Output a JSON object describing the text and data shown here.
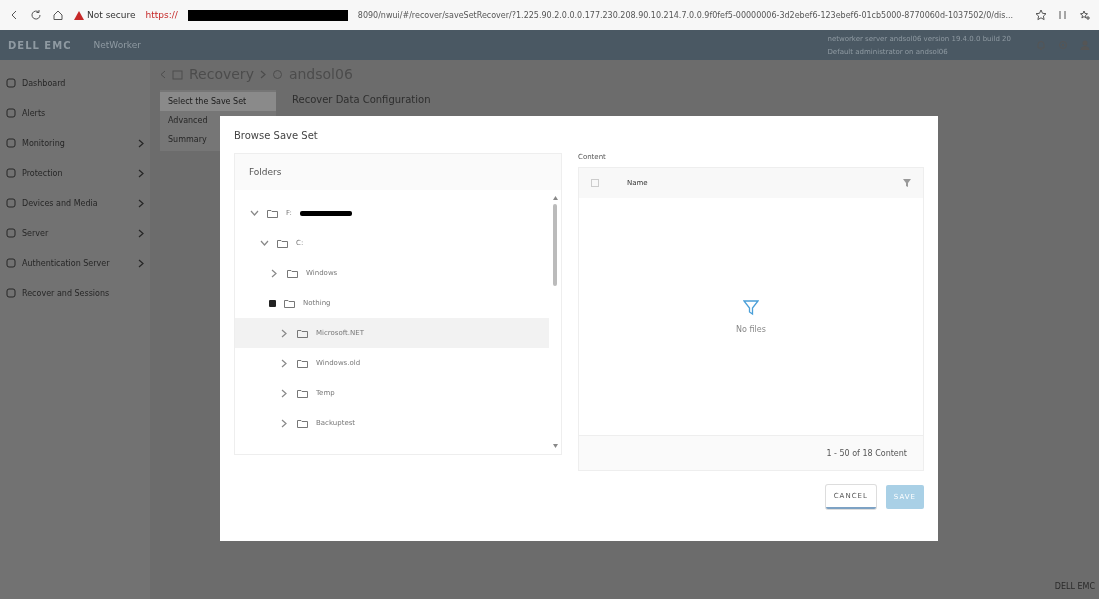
{
  "browser": {
    "security": "Not secure",
    "url_prefix": "https://",
    "url": "8090/nwui/#/recover/saveSetRecover/?1.225.90.2.0.0.0.177.230.208.90.10.214.7.0.0.9f0fef5-00000006-3d2ebef6-123ebef6-01cb5000-8770060d-1037502/0/dis..."
  },
  "header": {
    "brand": "DELL EMC",
    "product": "NetWorker",
    "server_line": "networker server andsol06 version 19.4.0.0 build 20",
    "user_line": "Default administrator on andsol06"
  },
  "sidebar": {
    "items": [
      {
        "label": "Dashboard",
        "has_submenu": false
      },
      {
        "label": "Alerts",
        "has_submenu": false
      },
      {
        "label": "Monitoring",
        "has_submenu": true
      },
      {
        "label": "Protection",
        "has_submenu": true
      },
      {
        "label": "Devices and Media",
        "has_submenu": true
      },
      {
        "label": "Server",
        "has_submenu": true
      },
      {
        "label": "Authentication Server",
        "has_submenu": true
      },
      {
        "label": "Recover and Sessions",
        "has_submenu": false
      }
    ]
  },
  "breadcrumb": {
    "first": "Recovery",
    "second": "andsol06"
  },
  "steps": [
    {
      "label": "Select the Save Set",
      "selected": true
    },
    {
      "label": "Advanced",
      "selected": false
    },
    {
      "label": "Summary",
      "selected": false
    }
  ],
  "section_title": "Recover Data Configuration",
  "dialog": {
    "title": "Browse Save Set",
    "folders_title": "Folders",
    "tree": [
      {
        "label": "F:",
        "redacted": true,
        "expanded": true,
        "checked": false,
        "selected": false,
        "children": [
          {
            "label": "C:",
            "expanded": true,
            "checked": false,
            "selected": false,
            "children": [
              {
                "label": "Windows",
                "expanded": false,
                "checked": false,
                "selected": false
              },
              {
                "label": "Nothing",
                "expanded": true,
                "checked": true,
                "selected": false,
                "children": [
                  {
                    "label": "Microsoft.NET",
                    "expanded": false,
                    "checked": false,
                    "selected": true
                  },
                  {
                    "label": "Windows.old",
                    "expanded": false,
                    "checked": false,
                    "selected": false
                  },
                  {
                    "label": "Temp",
                    "expanded": false,
                    "checked": false,
                    "selected": false
                  },
                  {
                    "label": "Backuptest",
                    "expanded": false,
                    "checked": false,
                    "selected": false
                  }
                ]
              }
            ]
          }
        ]
      }
    ],
    "content_label": "Content",
    "table": {
      "column": "Name",
      "select_all_checked": false,
      "empty_text": "No files",
      "footer": "1 - 50 of 18 Content"
    },
    "buttons": [
      {
        "label": "CANCEL",
        "kind": "secondary",
        "disabled": false
      },
      {
        "label": "SAVE",
        "kind": "primary",
        "disabled": true
      }
    ]
  },
  "corner_text": "DELL EMC"
}
